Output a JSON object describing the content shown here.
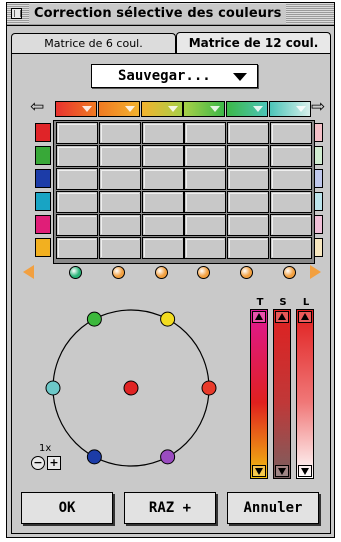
{
  "window": {
    "title": "Correction sélective des couleurs"
  },
  "tabs": [
    {
      "label": "Matrice de 6 coul.",
      "active": false
    },
    {
      "label": "Matrice de 12 coul.",
      "active": true
    }
  ],
  "preset_menu": {
    "selected": "Sauvegar..."
  },
  "navigation": {
    "prev_glyph": "⇦",
    "next_glyph": "⇨"
  },
  "column_colors": [
    "#e8322e",
    "#f07a22",
    "#f2b22e",
    "#a8d048",
    "#3cb848",
    "#4cc4b8"
  ],
  "row_colors": [
    "#e02428",
    "#38a838",
    "#1c3ca8",
    "#18a4c4",
    "#e01e78",
    "#f2b020"
  ],
  "right_tints": [
    "#f4c0c8",
    "#d0ecd0",
    "#c0c8ec",
    "#bce4ec",
    "#f0c0d8",
    "#f8e8c0"
  ],
  "bottom_dot_colors": [
    "#28b478",
    "#f2a040",
    "#f2a040",
    "#f2a040",
    "#f2a040",
    "#f2a040"
  ],
  "wheel_points": {
    "center": "#e02424",
    "points": [
      "#3cb83c",
      "#f2dc20",
      "#e83a2a",
      "#9a4cc0",
      "#1c3ca8",
      "#6cc8c8"
    ]
  },
  "sliders": {
    "labels": [
      "T",
      "S",
      "L"
    ],
    "gradients": [
      {
        "top": "#e01896",
        "mid": "#e0201e",
        "bottom": "#f2c010"
      },
      {
        "top": "#e02020",
        "mid": "#c03838",
        "bottom": "#7a6060"
      },
      {
        "top": "#e01e1e",
        "mid": "#f07878",
        "bottom": "#ffffff"
      }
    ]
  },
  "zoom": {
    "label": "1x",
    "minus": "−",
    "plus": "+"
  },
  "buttons": {
    "ok": "OK",
    "reset": "RAZ +",
    "cancel": "Annuler"
  }
}
